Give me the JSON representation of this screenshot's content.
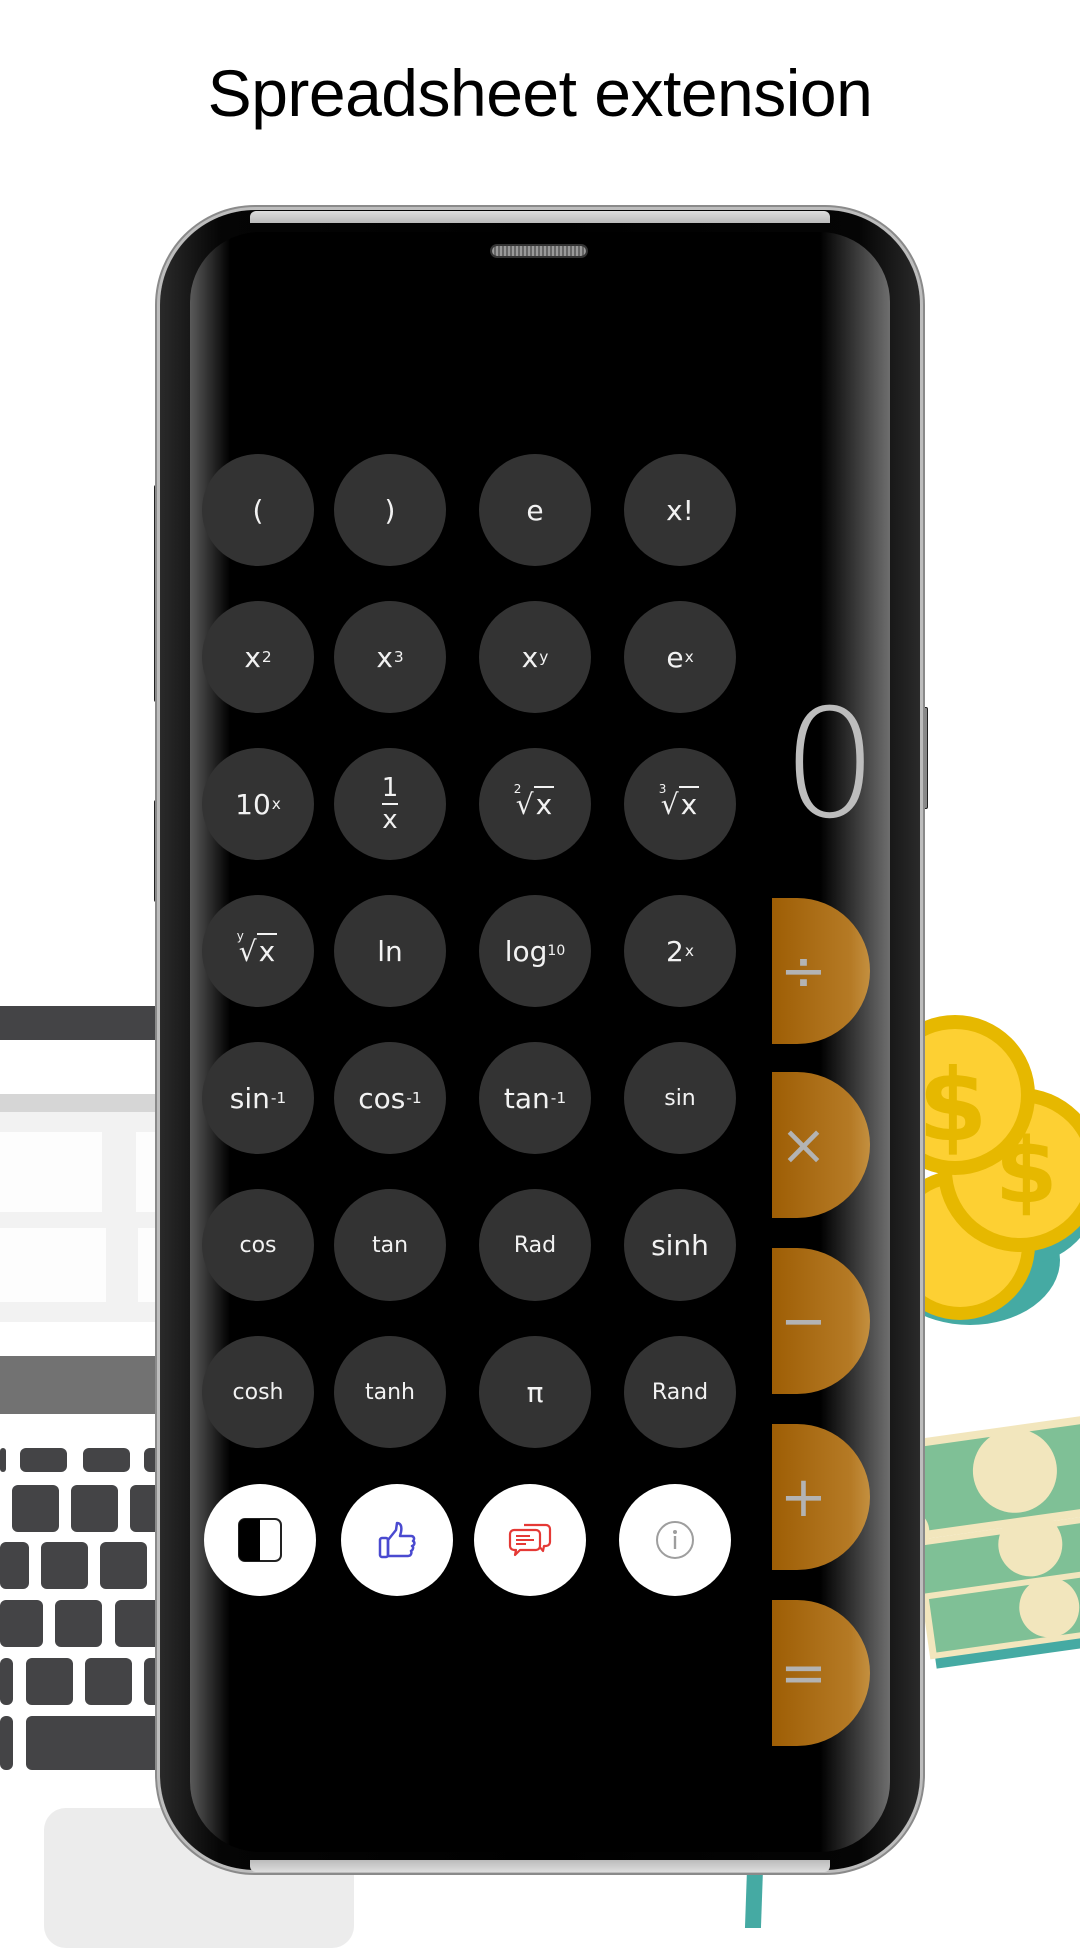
{
  "headline": "Spreadsheet extension",
  "display": {
    "value": "0"
  },
  "scientific_keys": [
    {
      "label": "("
    },
    {
      "label": ")"
    },
    {
      "label": "e"
    },
    {
      "label": "x!"
    },
    {
      "base": "x",
      "sup": "2"
    },
    {
      "base": "x",
      "sup": "3"
    },
    {
      "base": "x",
      "sup": "y"
    },
    {
      "base": "e",
      "sup": "x"
    },
    {
      "base": "10",
      "sup": "x"
    },
    {
      "num": "1",
      "den": "x"
    },
    {
      "index": "2",
      "radicand": "x"
    },
    {
      "index": "3",
      "radicand": "x"
    },
    {
      "index": "y",
      "radicand": "x"
    },
    {
      "label": "ln"
    },
    {
      "base": "log",
      "sub": "10"
    },
    {
      "base": "2",
      "sup": "x"
    },
    {
      "base": "sin",
      "sup": "-1"
    },
    {
      "base": "cos",
      "sup": "-1"
    },
    {
      "base": "tan",
      "sup": "-1"
    },
    {
      "label": "sin"
    },
    {
      "label": "cos"
    },
    {
      "label": "tan"
    },
    {
      "label": "Rad"
    },
    {
      "label": "sinh"
    },
    {
      "label": "cosh"
    },
    {
      "label": "tanh"
    },
    {
      "label": "π"
    },
    {
      "label": "Rand"
    }
  ],
  "utility_keys": [
    {
      "icon": "theme-toggle-icon"
    },
    {
      "icon": "thumbs-up-icon"
    },
    {
      "icon": "feedback-chat-icon"
    },
    {
      "icon": "info-icon"
    }
  ],
  "operators": [
    {
      "label": "÷",
      "name": "divide"
    },
    {
      "label": "×",
      "name": "multiply"
    },
    {
      "label": "−",
      "name": "subtract"
    },
    {
      "label": "+",
      "name": "add"
    },
    {
      "label": "=",
      "name": "equals"
    }
  ],
  "colors": {
    "operator_accent": "#A8650F",
    "key_background": "#333333",
    "thumbs_up": "#4A4AD0",
    "feedback": "#E53935",
    "info": "#9E9E9E"
  }
}
